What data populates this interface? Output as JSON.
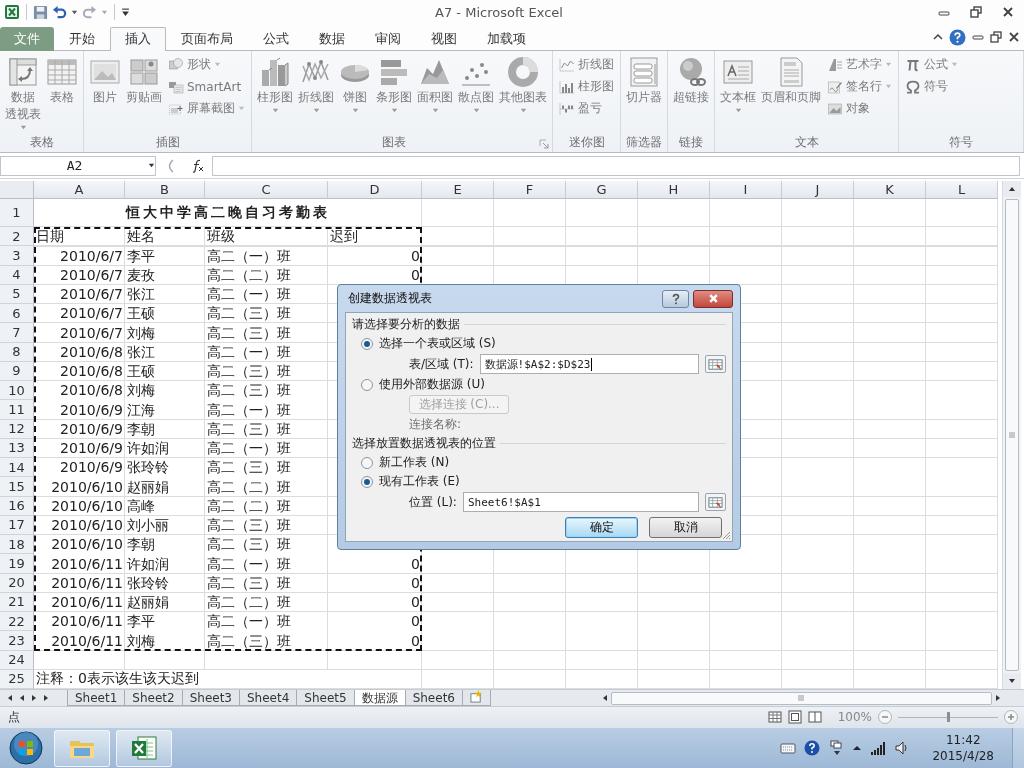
{
  "window": {
    "title": "A7 - Microsoft Excel"
  },
  "ribbon_tabs": [
    {
      "label": "文件",
      "kind": "file",
      "selected": false
    },
    {
      "label": "开始",
      "kind": "tab",
      "selected": false
    },
    {
      "label": "插入",
      "kind": "tab",
      "selected": true
    },
    {
      "label": "页面布局",
      "kind": "tab",
      "selected": false
    },
    {
      "label": "公式",
      "kind": "tab",
      "selected": false
    },
    {
      "label": "数据",
      "kind": "tab",
      "selected": false
    },
    {
      "label": "审阅",
      "kind": "tab",
      "selected": false
    },
    {
      "label": "视图",
      "kind": "tab",
      "selected": false
    },
    {
      "label": "加载项",
      "kind": "tab",
      "selected": false
    }
  ],
  "ribbon": {
    "dimmed": true,
    "groups": [
      {
        "label": "表格",
        "items": [
          {
            "kind": "large",
            "lines": [
              "数据",
              "透视表"
            ],
            "dropdown": true
          },
          {
            "kind": "large",
            "label": "表格",
            "dropdown": false
          }
        ]
      },
      {
        "label": "插图",
        "items": [
          {
            "kind": "large",
            "label": "图片",
            "dropdown": false
          },
          {
            "kind": "large",
            "label": "剪贴画",
            "dropdown": false
          },
          {
            "kind": "small",
            "label": "形状",
            "dropdown": true
          },
          {
            "kind": "small",
            "label": "SmartArt",
            "dropdown": false
          },
          {
            "kind": "small",
            "label": "屏幕截图",
            "dropdown": true
          }
        ]
      },
      {
        "label": "图表",
        "launcher": true,
        "items": [
          {
            "kind": "large",
            "label": "柱形图",
            "dropdown": true
          },
          {
            "kind": "large",
            "label": "折线图",
            "dropdown": true
          },
          {
            "kind": "large",
            "label": "饼图",
            "dropdown": true
          },
          {
            "kind": "large",
            "label": "条形图",
            "dropdown": true
          },
          {
            "kind": "large",
            "label": "面积图",
            "dropdown": true
          },
          {
            "kind": "large",
            "label": "散点图",
            "dropdown": true
          },
          {
            "kind": "large",
            "label": "其他图表",
            "dropdown": true
          }
        ]
      },
      {
        "label": "迷你图",
        "items": [
          {
            "kind": "small",
            "label": "折线图",
            "dropdown": false
          },
          {
            "kind": "small",
            "label": "柱形图",
            "dropdown": false
          },
          {
            "kind": "small",
            "label": "盈亏",
            "dropdown": false
          }
        ]
      },
      {
        "label": "筛选器",
        "items": [
          {
            "kind": "large",
            "label": "切片器",
            "dropdown": false
          }
        ]
      },
      {
        "label": "链接",
        "items": [
          {
            "kind": "large",
            "label": "超链接",
            "dropdown": false
          }
        ]
      },
      {
        "label": "文本",
        "items": [
          {
            "kind": "large",
            "label": "文本框",
            "dropdown": true
          },
          {
            "kind": "large",
            "label": "页眉和页脚",
            "dropdown": false
          },
          {
            "kind": "small",
            "label": "艺术字",
            "dropdown": true
          },
          {
            "kind": "small",
            "label": "签名行",
            "dropdown": true
          },
          {
            "kind": "small",
            "label": "对象",
            "dropdown": false
          }
        ]
      },
      {
        "label": "符号",
        "items": [
          {
            "kind": "small",
            "label": "公式",
            "dropdown": true
          },
          {
            "kind": "small",
            "label": "符号",
            "dropdown": false
          }
        ]
      }
    ]
  },
  "formula_bar": {
    "name_box": "A2"
  },
  "sheet": {
    "copy_marquee": true,
    "columns": [
      "A",
      "B",
      "C",
      "D",
      "E",
      "F",
      "G",
      "H",
      "I",
      "J",
      "K",
      "L"
    ],
    "rows": [
      {
        "number": "1",
        "kind": "title",
        "cells": [
          "恒大中学高二晚自习考勤表"
        ]
      },
      {
        "number": "2",
        "kind": "header",
        "cells": [
          "日期",
          "姓名",
          "班级",
          "迟到"
        ]
      },
      {
        "number": "3",
        "kind": "data",
        "cells": [
          "2010/6/7",
          "李平",
          "高二（一）班",
          "0"
        ]
      },
      {
        "number": "4",
        "kind": "data",
        "cells": [
          "2010/6/7",
          "麦孜",
          "高二（二）班",
          "0"
        ]
      },
      {
        "number": "5",
        "kind": "data",
        "cells": [
          "2010/6/7",
          "张江",
          "高二（一）班"
        ]
      },
      {
        "number": "6",
        "kind": "data",
        "cells": [
          "2010/6/7",
          "王硕",
          "高二（三）班"
        ]
      },
      {
        "number": "7",
        "kind": "data",
        "cells": [
          "2010/6/7",
          "刘梅",
          "高二（三）班"
        ]
      },
      {
        "number": "8",
        "kind": "data",
        "cells": [
          "2010/6/8",
          "张江",
          "高二（一）班"
        ]
      },
      {
        "number": "9",
        "kind": "data",
        "cells": [
          "2010/6/8",
          "王硕",
          "高二（三）班"
        ]
      },
      {
        "number": "10",
        "kind": "data",
        "cells": [
          "2010/6/8",
          "刘梅",
          "高二（三）班"
        ]
      },
      {
        "number": "11",
        "kind": "data",
        "cells": [
          "2010/6/9",
          "江海",
          "高二（一）班"
        ]
      },
      {
        "number": "12",
        "kind": "data",
        "cells": [
          "2010/6/9",
          "李朝",
          "高二（三）班"
        ]
      },
      {
        "number": "13",
        "kind": "data",
        "cells": [
          "2010/6/9",
          "许如润",
          "高二（一）班"
        ]
      },
      {
        "number": "14",
        "kind": "data",
        "cells": [
          "2010/6/9",
          "张玲铃",
          "高二（三）班"
        ]
      },
      {
        "number": "15",
        "kind": "data",
        "cells": [
          "2010/6/10",
          "赵丽娟",
          "高二（二）班"
        ]
      },
      {
        "number": "16",
        "kind": "data",
        "cells": [
          "2010/6/10",
          "高峰",
          "高二（二）班"
        ]
      },
      {
        "number": "17",
        "kind": "data",
        "cells": [
          "2010/6/10",
          "刘小丽",
          "高二（三）班"
        ]
      },
      {
        "number": "18",
        "kind": "data",
        "cells": [
          "2010/6/10",
          "李朝",
          "高二（三）班"
        ]
      },
      {
        "number": "19",
        "kind": "data",
        "cells": [
          "2010/6/11",
          "许如润",
          "高二（一）班",
          "0"
        ]
      },
      {
        "number": "20",
        "kind": "data",
        "cells": [
          "2010/6/11",
          "张玲铃",
          "高二（三）班",
          "0"
        ]
      },
      {
        "number": "21",
        "kind": "data",
        "cells": [
          "2010/6/11",
          "赵丽娟",
          "高二（二）班",
          "0"
        ]
      },
      {
        "number": "22",
        "kind": "data",
        "cells": [
          "2010/6/11",
          "李平",
          "高二（一）班",
          "0"
        ]
      },
      {
        "number": "23",
        "kind": "data",
        "cells": [
          "2010/6/11",
          "刘梅",
          "高二（三）班",
          "0"
        ]
      },
      {
        "number": "24",
        "kind": "empty"
      },
      {
        "number": "25",
        "kind": "note",
        "cells": [
          "注释：0表示该生该天迟到"
        ]
      }
    ]
  },
  "dialog": {
    "title": "创建数据透视表",
    "sections": [
      {
        "heading": "请选择要分析的数据",
        "options": [
          {
            "label": "选择一个表或区域 (S)",
            "selected": true,
            "field": {
              "label": "表/区域 (T):",
              "value": "数据源!$A$2:$D$23",
              "focused": true
            }
          },
          {
            "label": "使用外部数据源 (U)",
            "selected": false,
            "connection": {
              "button": "选择连接 (C)...",
              "disabled": true,
              "name_label": "连接名称:"
            }
          }
        ]
      },
      {
        "heading": "选择放置数据透视表的位置",
        "options": [
          {
            "label": "新工作表 (N)",
            "selected": false
          },
          {
            "label": "现有工作表 (E)",
            "selected": true,
            "field": {
              "label": "位置 (L):",
              "value": "Sheet6!$A$1",
              "focused": false
            }
          }
        ]
      }
    ],
    "buttons": [
      {
        "label": "确定",
        "default": true
      },
      {
        "label": "取消",
        "default": false
      }
    ]
  },
  "sheet_tabs": [
    {
      "label": "Sheet1",
      "selected": false
    },
    {
      "label": "Sheet2",
      "selected": false
    },
    {
      "label": "Sheet3",
      "selected": false
    },
    {
      "label": "Sheet4",
      "selected": false
    },
    {
      "label": "Sheet5",
      "selected": false
    },
    {
      "label": "数据源",
      "selected": true
    },
    {
      "label": "Sheet6",
      "selected": false
    }
  ],
  "status_bar": {
    "mode": "点",
    "zoom": {
      "reading": "100%",
      "level": 0.5
    }
  },
  "taskbar": {
    "time": "11:42",
    "date": "2015/4/28"
  }
}
